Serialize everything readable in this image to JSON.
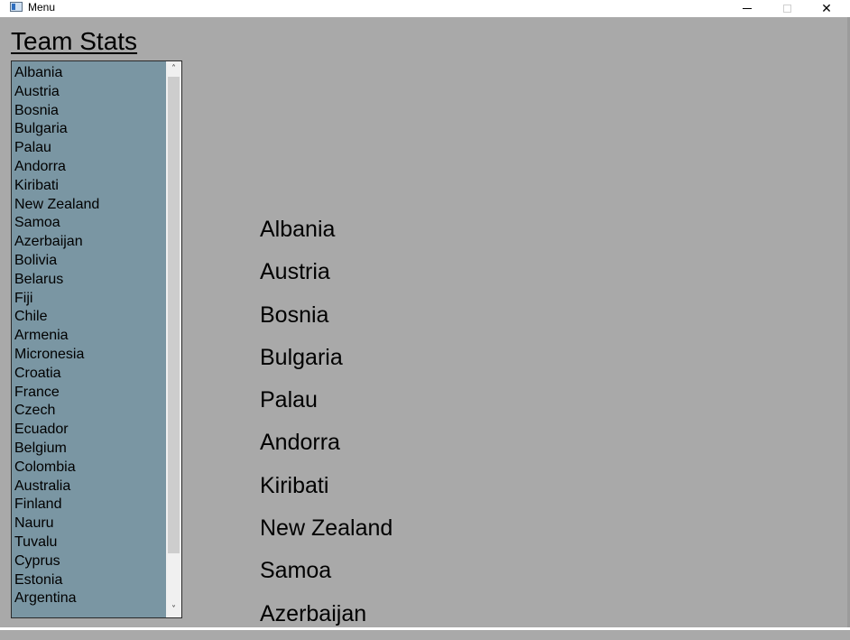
{
  "window": {
    "title": "Menu",
    "minimize_glyph": "–",
    "maximize_glyph": "□",
    "close_glyph": "✕"
  },
  "page": {
    "title": "Team Stats"
  },
  "team_list": {
    "items": [
      "Albania",
      "Austria",
      "Bosnia",
      "Bulgaria",
      "Palau",
      "Andorra",
      "Kiribati",
      "New Zealand",
      "Samoa",
      "Azerbaijan",
      "Bolivia",
      "Belarus",
      "Fiji",
      "Chile",
      "Armenia",
      "Micronesia",
      "Croatia",
      "France",
      "Czech",
      "Ecuador",
      "Belgium",
      "Colombia",
      "Australia",
      "Finland",
      "Nauru",
      "Tuvalu",
      "Cyprus",
      "Estonia",
      "Argentina"
    ],
    "scroll_up_glyph": "˄",
    "scroll_down_glyph": "˅"
  },
  "detail_list": {
    "items": [
      "Albania",
      "Austria",
      "Bosnia",
      "Bulgaria",
      "Palau",
      "Andorra",
      "Kiribati",
      "New Zealand",
      "Samoa",
      "Azerbaijan"
    ]
  }
}
